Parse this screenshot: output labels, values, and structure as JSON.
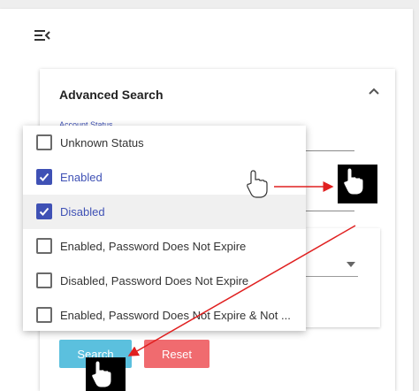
{
  "header": {
    "menu_icon": "menu-collapse-icon"
  },
  "panel": {
    "title": "Advanced Search",
    "collapse_icon": "chevron-up-icon",
    "field_label": "Account Status"
  },
  "dropdown": {
    "options": [
      {
        "label": "Unknown Status",
        "checked": false
      },
      {
        "label": "Enabled",
        "checked": true
      },
      {
        "label": "Disabled",
        "checked": true
      },
      {
        "label": "Enabled, Password Does Not Expire",
        "checked": false
      },
      {
        "label": "Disabled, Password Does Not Expire",
        "checked": false
      },
      {
        "label": "Enabled, Password Does Not Expire & Not ...",
        "checked": false
      }
    ]
  },
  "actions": {
    "search_label": "Search",
    "reset_label": "Reset"
  },
  "annotations": {
    "arrow_color": "#e02020",
    "accent_color": "#3f51b5"
  }
}
